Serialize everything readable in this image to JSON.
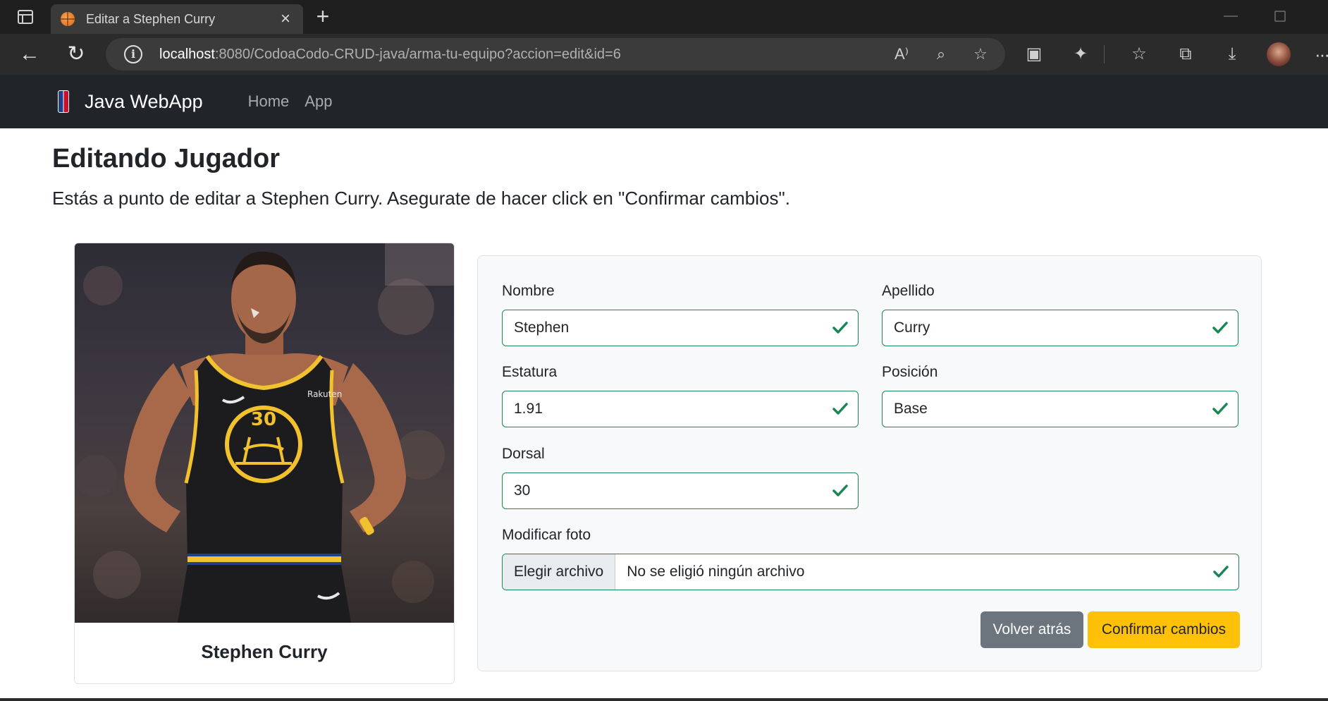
{
  "browser": {
    "tab_title": "Editar a Stephen Curry",
    "url_host": "localhost",
    "url_rest": ":8080/CodoaCodo-CRUD-java/arma-tu-equipo?accion=edit&id=6",
    "icons": {
      "tab_actions": "tab-actions-icon",
      "favicon": "basketball-icon",
      "close_tab": "×",
      "new_tab": "+",
      "back": "←",
      "refresh": "↻",
      "info": "i",
      "read_aloud": "A⁾",
      "zoom": "⌕",
      "favorite_add": "☆",
      "tool1": "▣",
      "extensions": "✦",
      "favorites": "☆",
      "collections": "⧉",
      "downloads": "⤓",
      "more": "···"
    }
  },
  "navbar": {
    "brand": "Java WebApp",
    "links": [
      "Home",
      "App"
    ]
  },
  "page": {
    "title": "Editando Jugador",
    "lead": "Estás a punto de editar a Stephen Curry. Asegurate de hacer click en \"Confirmar cambios\"."
  },
  "card": {
    "player_name": "Stephen Curry",
    "jersey_number": "30",
    "sponsor": "Rakuten"
  },
  "form": {
    "nombre": {
      "label": "Nombre",
      "value": "Stephen"
    },
    "apellido": {
      "label": "Apellido",
      "value": "Curry"
    },
    "estatura": {
      "label": "Estatura",
      "value": "1.91"
    },
    "posicion": {
      "label": "Posición",
      "value": "Base"
    },
    "dorsal": {
      "label": "Dorsal",
      "value": "30"
    },
    "foto": {
      "label": "Modificar foto",
      "button": "Elegir archivo",
      "status": "No se eligió ningún archivo"
    },
    "back_button": "Volver atrás",
    "confirm_button": "Confirmar cambios",
    "valid_color": "#198754"
  }
}
